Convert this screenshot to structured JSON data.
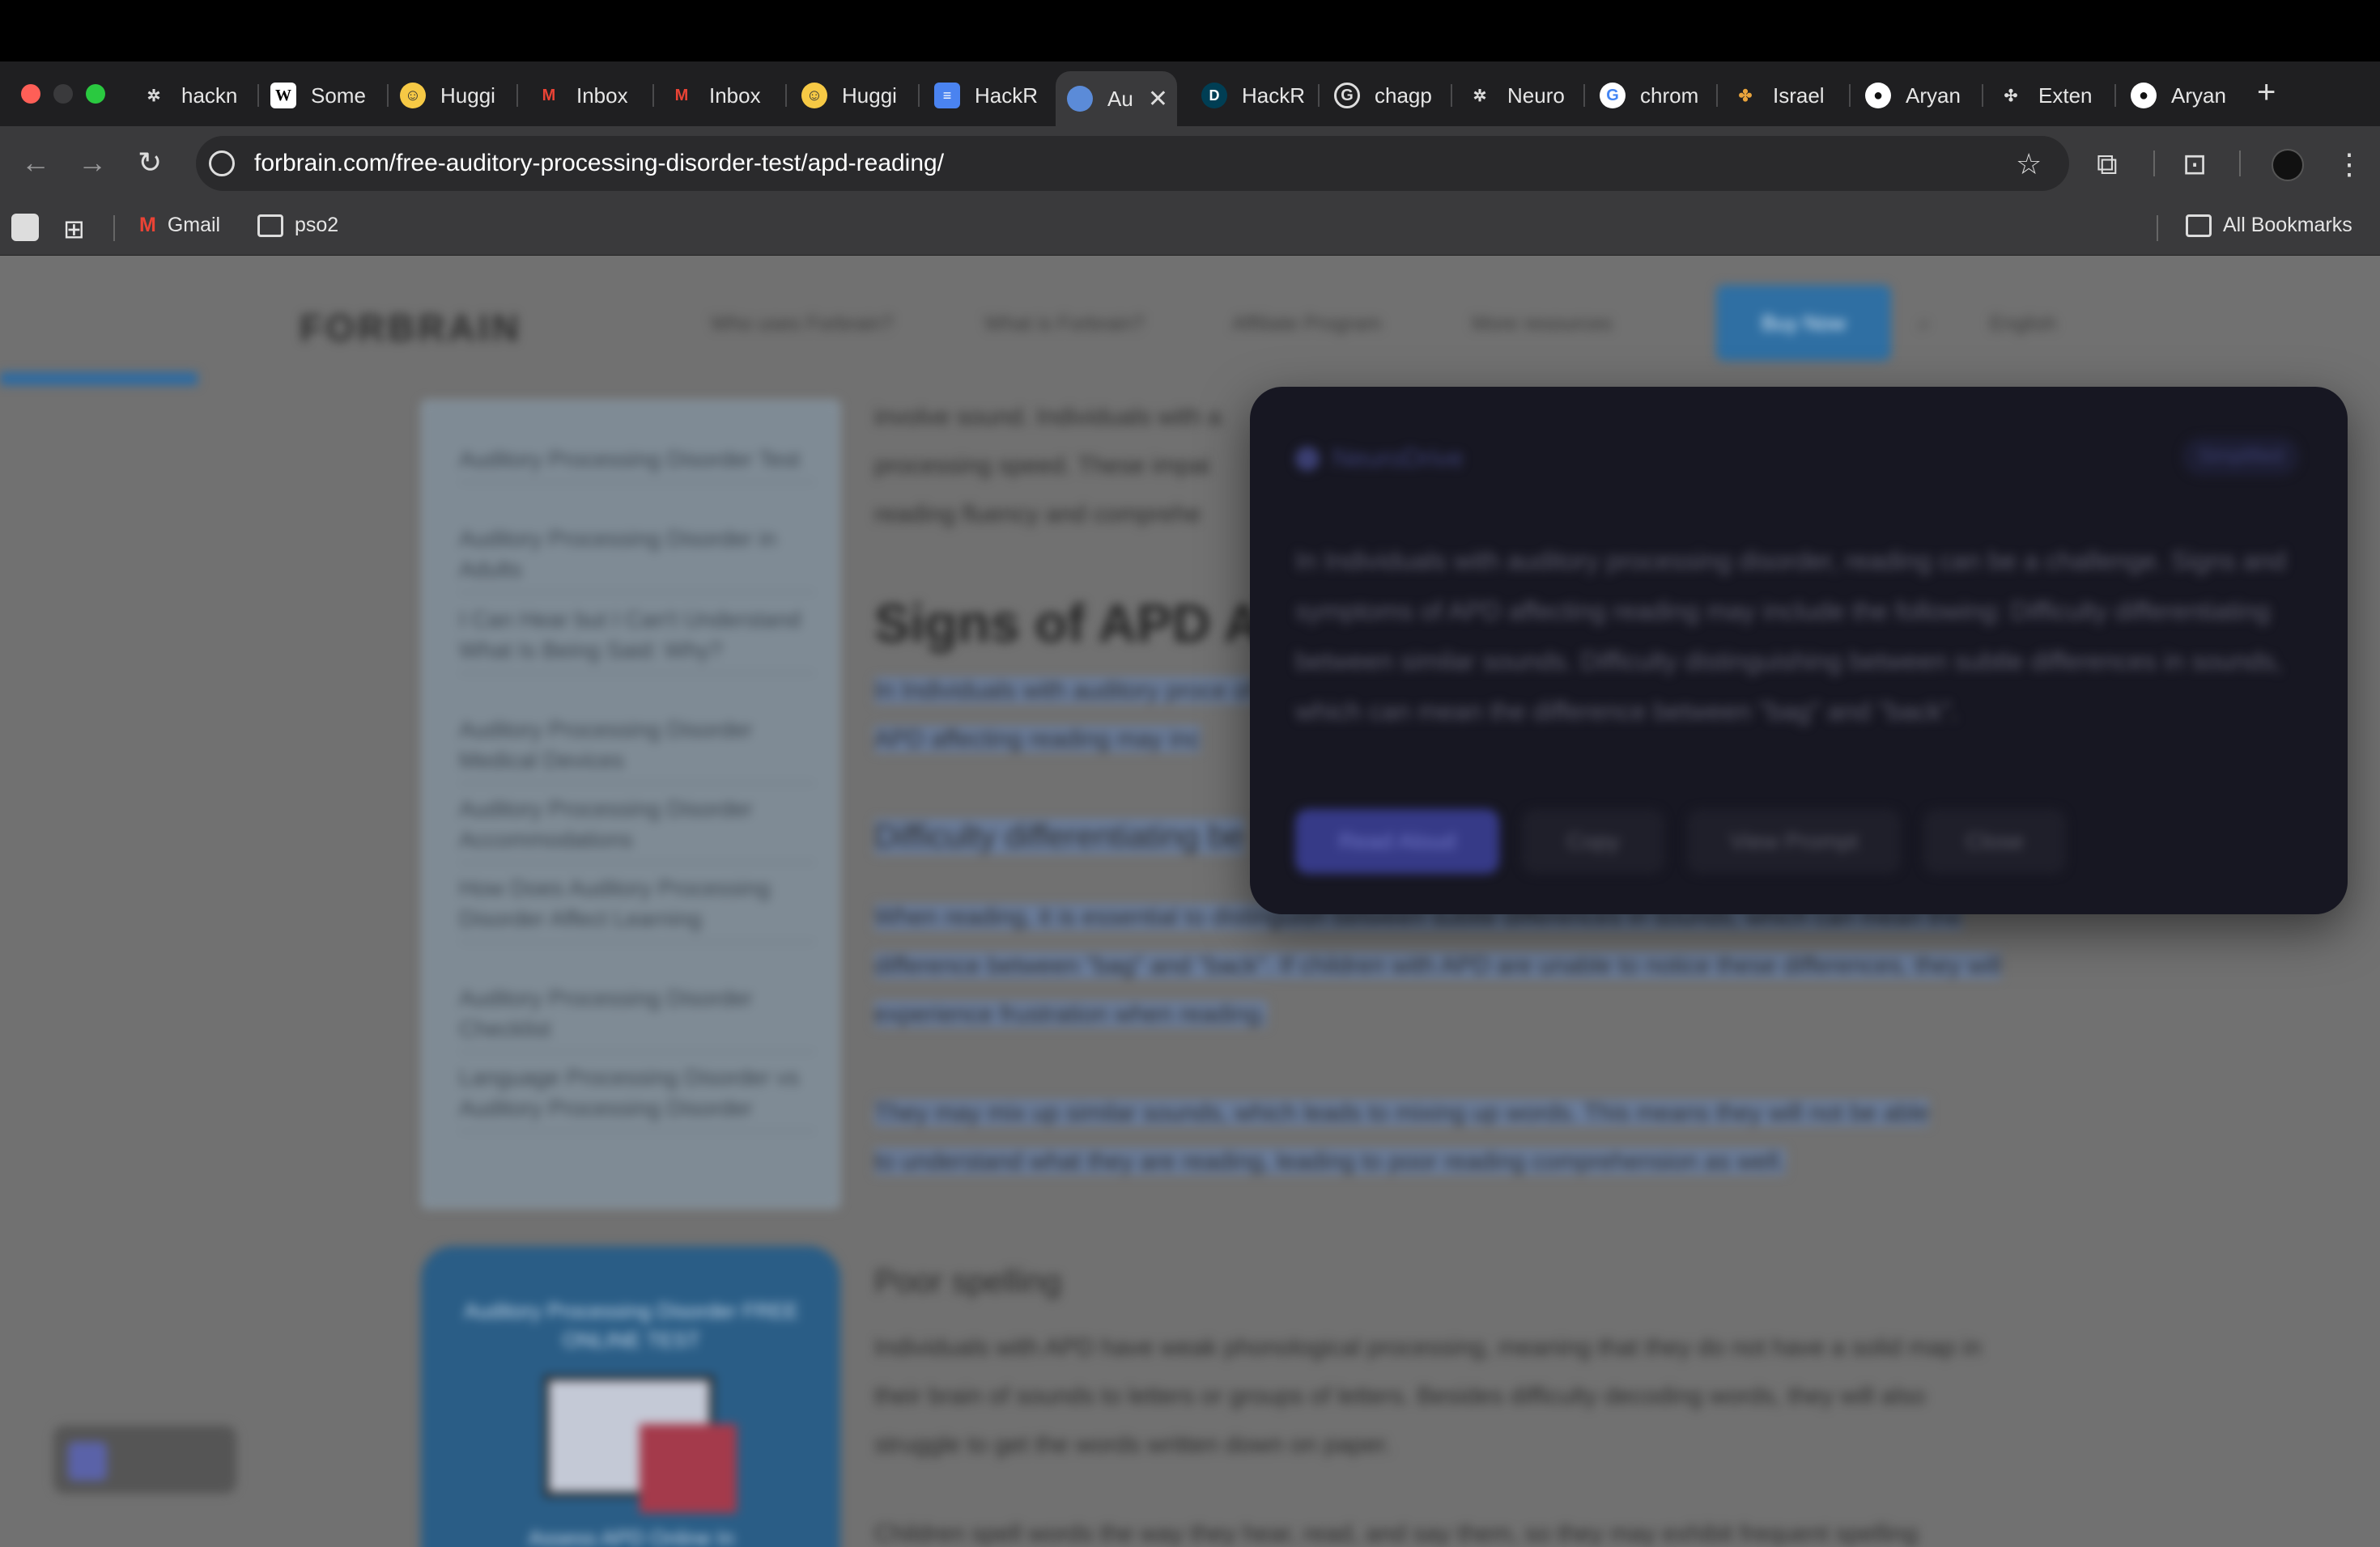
{
  "browser": {
    "tabs": [
      {
        "title": "hackn",
        "favicon": "chatgpt-icon",
        "active": false
      },
      {
        "title": "Some",
        "favicon": "wikipedia-icon",
        "active": false
      },
      {
        "title": "Huggi",
        "favicon": "huggingface-icon",
        "active": false
      },
      {
        "title": "Inbox",
        "favicon": "gmail-icon",
        "active": false
      },
      {
        "title": "Inbox",
        "favicon": "gmail-icon",
        "active": false
      },
      {
        "title": "Huggi",
        "favicon": "huggingface-icon",
        "active": false
      },
      {
        "title": "HackR",
        "favicon": "google-docs-icon",
        "active": false
      },
      {
        "title": "Au",
        "favicon": "globe-icon",
        "active": true
      },
      {
        "title": "HackR",
        "favicon": "devpost-icon",
        "active": false
      },
      {
        "title": "chagp",
        "favicon": "google-icon",
        "active": false
      },
      {
        "title": "Neuro",
        "favicon": "chatgpt-icon",
        "active": false
      },
      {
        "title": "chrom",
        "favicon": "google-icon",
        "active": false
      },
      {
        "title": "Israel",
        "favicon": "nbc-icon",
        "active": false
      },
      {
        "title": "Aryan",
        "favicon": "github-icon",
        "active": false
      },
      {
        "title": "Exten",
        "favicon": "puzzle-icon",
        "active": false
      },
      {
        "title": "Aryan",
        "favicon": "github-icon",
        "active": false
      }
    ],
    "new_tab_label": "+",
    "close_glyph": "✕",
    "url": "forbrain.com/free-auditory-processing-disorder-test/apd-reading/",
    "bookmarks": [
      {
        "label": "Gmail",
        "icon": "gmail-icon"
      },
      {
        "label": "pso2",
        "icon": "folder-icon"
      }
    ],
    "all_bookmarks_label": "All Bookmarks"
  },
  "page": {
    "logo": "FORBRAIN",
    "nav": [
      "Who uses Forbrain?",
      "What is Forbrain?",
      "Affiliate Program",
      "More resources"
    ],
    "buy_label": "Buy Now",
    "language": "English",
    "reading_progress": 0.083,
    "toc": [
      "Auditory Processing Disorder Test",
      "Auditory Processing Disorder in Adults",
      "I Can Hear but I Can't Understand What Is Being Said: Why?",
      "Auditory Processing Disorder Medical Devices",
      "Auditory Processing Disorder Accommodations",
      "How Does Auditory Processing Disorder Affect Learning",
      "Auditory Processing Disorder Checklist",
      "Language Processing Disorder vs Auditory Processing Disorder"
    ],
    "promo": {
      "title": "Auditory Processing Disorder FREE ONLINE TEST",
      "subtitle": "Assess APD Online In"
    },
    "article": {
      "intro": "involve sound. Individuals with a processing speed. These impai reading fluency and comprehe",
      "heading": "Signs of APD A",
      "highlight_intro": "In Individuals with auditory proce of APD affecting reading may inc",
      "subheading_1": "Difficulty differentiating be",
      "para_1": "When reading, it is essential to distinguish between subtle differences in sounds, which can mean the difference between \"bag\" and \"back\". If children with APD are unable to notice these differences, they will experience frustration when reading.",
      "para_2": "They may mix up similar sounds, which leads to mixing up words. This means they will not be able to understand what they are reading, leading to poor reading comprehension as well.",
      "subheading_2": "Poor spelling",
      "para_3": "Individuals with APD have weak phonological processing, meaning that they do not have a solid map in their brain of sounds to letters or groups of letters. Besides difficulty decoding words, they will also struggle to get the words written down on paper.",
      "para_4": "Children spell words the way they hear, read, and say them, so they may exhibit frequent spelling"
    }
  },
  "popup": {
    "brand": "NeuroDrive",
    "tag": "Simplified",
    "text": "In Individuals with auditory processing disorder, reading can be a challenge. Signs and symptoms of APD affecting reading may include the following: Difficulty differentiating between similar sounds. Difficulty distinguishing between subtle differences in sounds, which can mean the difference between \"bag\" and \"back\".",
    "buttons": {
      "read_aloud": "Read Aloud",
      "copy": "Copy",
      "view_prompt": "View Prompt",
      "close": "Close"
    }
  }
}
